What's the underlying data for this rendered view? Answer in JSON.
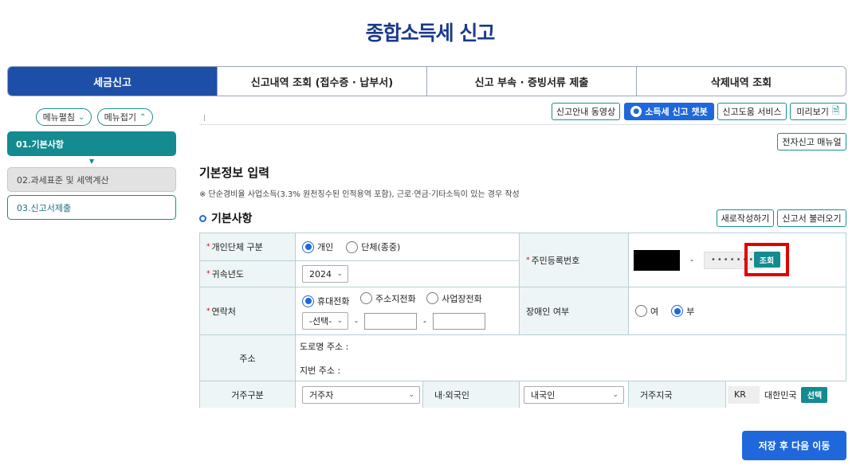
{
  "page_title": "종합소득세 신고",
  "main_tabs": [
    {
      "label": "세금신고",
      "active": true
    },
    {
      "label": "신고내역 조회 (접수증 · 납부서)",
      "active": false
    },
    {
      "label": "신고 부속 · 증빙서류 제출",
      "active": false
    },
    {
      "label": "삭제내역 조회",
      "active": false
    }
  ],
  "sidebar": {
    "expand_label": "메뉴펼침",
    "collapse_label": "메뉴접기",
    "steps": [
      {
        "label": "01.기본사항",
        "state": "active"
      },
      {
        "label": "02.과세표준 및 세액계산",
        "state": "done"
      },
      {
        "label": "03.신고서제출",
        "state": "next"
      }
    ]
  },
  "toolbar": {
    "guide_video": "신고안내 동영상",
    "chatbot": "소득세 신고 챗봇",
    "help_service": "신고도움 서비스",
    "preview": "미리보기",
    "manual": "전자신고 매뉴얼"
  },
  "section": {
    "title": "기본정보 입력",
    "notice": "※ 단순경비율 사업소득(3.3% 원천징수된 인적용역 포함), 근로·연금·기타소득이 있는 경우 작성",
    "subtitle": "기본사항",
    "new_button": "새로작성하기",
    "load_button": "신고서 불러오기"
  },
  "form": {
    "entity_type": {
      "label": "개인단체 구분",
      "options": [
        "개인",
        "단체(종중)"
      ],
      "selected": "개인"
    },
    "year": {
      "label": "귀속년도",
      "value": "2024"
    },
    "rrn": {
      "label": "주민등록번호",
      "separator": "-",
      "masked": "•••••••",
      "lookup": "조회"
    },
    "contact": {
      "label": "연락처",
      "options": [
        "휴대전화",
        "주소지전화",
        "사업장전화"
      ],
      "selected": "휴대전화",
      "prefix_placeholder": "-선택-",
      "separator": "-"
    },
    "disability": {
      "label": "장애인 여부",
      "options": [
        "여",
        "부"
      ],
      "selected": "부"
    },
    "address": {
      "label": "주소",
      "road": "도로명 주소 :",
      "lot": "지번 주소 :"
    },
    "residency": {
      "label": "거주구분",
      "value": "거주자"
    },
    "nationality": {
      "label": "내·외국인",
      "value": "내국인"
    },
    "country": {
      "label": "거주지국",
      "code": "KR",
      "name": "대한민국",
      "select": "선택"
    }
  },
  "save_next": "저장 후 다음 이동",
  "colors": {
    "brand_navy": "#1e4fa8",
    "teal": "#138b90",
    "action_blue": "#1e68dc",
    "highlight_red": "#e00000"
  }
}
